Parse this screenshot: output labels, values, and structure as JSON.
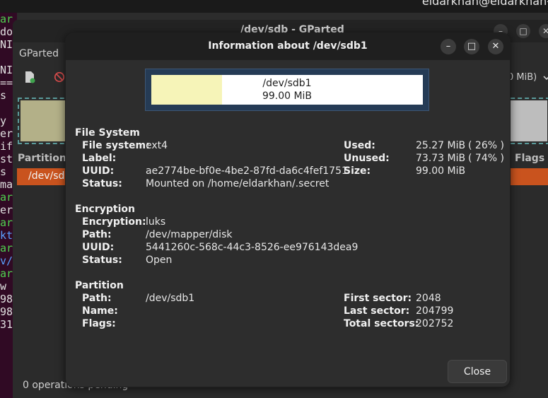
{
  "topbar": {
    "user": "eldarkhan@eldarkhan-"
  },
  "terminal": {
    "lines": [
      {
        "t": "ar",
        "c": "#4fd14f"
      },
      {
        "t": "do",
        "c": "#e0e0e0"
      },
      {
        "t": "NI",
        "c": "#e0e0e0"
      },
      {
        "t": "",
        "c": "#e0e0e0"
      },
      {
        "t": "NI",
        "c": "#e0e0e0"
      },
      {
        "t": "==",
        "c": "#e0e0e0"
      },
      {
        "t": "s",
        "c": "#e0e0e0"
      },
      {
        "t": "",
        "c": "#e0e0e0"
      },
      {
        "t": "y",
        "c": "#e0e0e0"
      },
      {
        "t": "er",
        "c": "#e0e0e0"
      },
      {
        "t": "if",
        "c": "#e0e0e0"
      },
      {
        "t": "st",
        "c": "#e0e0e0"
      },
      {
        "t": "s",
        "c": "#e0e0e0"
      },
      {
        "t": "ma",
        "c": "#e0e0e0"
      },
      {
        "t": "ar",
        "c": "#4fd14f"
      },
      {
        "t": "er",
        "c": "#e0e0e0"
      },
      {
        "t": "ar",
        "c": "#4fd14f"
      },
      {
        "t": "kt",
        "c": "#5aa0ff"
      },
      {
        "t": "ar",
        "c": "#4fd14f"
      },
      {
        "t": "v/",
        "c": "#5aa0ff"
      },
      {
        "t": "ar",
        "c": "#4fd14f"
      },
      {
        "t": "w",
        "c": "#e0e0e0"
      },
      {
        "t": "98",
        "c": "#e0e0e0"
      },
      {
        "t": "98",
        "c": "#e0e0e0"
      },
      {
        "t": "31",
        "c": "#e0e0e0"
      }
    ]
  },
  "gparted": {
    "title": "/dev/sdb - GParted",
    "menu": "GParted",
    "device_selector": "0 MiB)",
    "columns": {
      "partition": "Partition",
      "flags": "Flags"
    },
    "row_partition": "/dev/sdb",
    "status": "0 operations pending",
    "btn_min": "–",
    "btn_max": "□",
    "btn_close": "✕"
  },
  "dialog": {
    "title": "Information about /dev/sdb1",
    "btn_min": "–",
    "btn_max": "□",
    "btn_close": "✕",
    "usage": {
      "device": "/dev/sdb1",
      "size": "99.00 MiB",
      "used_fraction": 0.26
    },
    "filesystem": {
      "heading": "File System",
      "fs_label": "File system:",
      "fs_value": "ext4",
      "label_label": "Label:",
      "label_value": "",
      "uuid_label": "UUID:",
      "uuid_value": "ae2774be-bf0e-4be2-87fd-da6c4fef1751",
      "status_label": "Status:",
      "status_value": "Mounted on /home/eldarkhan/.secret",
      "used_label": "Used:",
      "used_value": "25.27 MiB",
      "used_pct": "( 26% )",
      "unused_label": "Unused:",
      "unused_value": "73.73 MiB",
      "unused_pct": "( 74% )",
      "size_label": "Size:",
      "size_value": "99.00 MiB"
    },
    "encryption": {
      "heading": "Encryption",
      "enc_label": "Encryption:",
      "enc_value": "luks",
      "path_label": "Path:",
      "path_value": "/dev/mapper/disk",
      "uuid_label": "UUID:",
      "uuid_value": "5441260c-568c-44c3-8526-ee976143dea9",
      "status_label": "Status:",
      "status_value": "Open"
    },
    "partition": {
      "heading": "Partition",
      "path_label": "Path:",
      "path_value": "/dev/sdb1",
      "name_label": "Name:",
      "name_value": "",
      "flags_label": "Flags:",
      "flags_value": "",
      "first_label": "First sector:",
      "first_value": "2048",
      "last_label": "Last sector:",
      "last_value": "204799",
      "total_label": "Total sectors:",
      "total_value": "202752"
    },
    "close_label": "Close"
  }
}
